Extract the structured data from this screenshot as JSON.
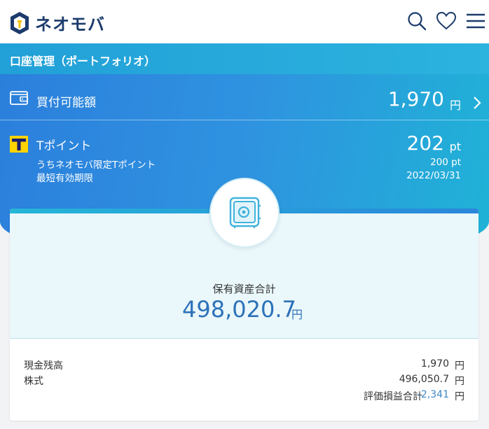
{
  "header": {
    "brand": "ネオモバ",
    "icons": [
      "search-icon",
      "heart-icon",
      "menu-icon"
    ]
  },
  "title_bar": {
    "title": "口座管理（ポートフォリオ）"
  },
  "buying_power": {
    "label": "買付可能額",
    "amount": "1,970",
    "unit": "円"
  },
  "tpoint": {
    "label": "Tポイント",
    "value": "202",
    "unit": "pt",
    "limited_label": "うちネオモバ限定Tポイント",
    "limited_value": "200 pt",
    "expiry_label": "最短有効期限",
    "expiry_value": "2022/03/31"
  },
  "assets": {
    "total_label": "保有資産合計",
    "total_value": "498,020.7",
    "unit": "円",
    "rows": [
      {
        "label": "現金残高",
        "value": "1,970",
        "unit": "円"
      },
      {
        "label": "株式",
        "value": "496,050.7",
        "unit": "円"
      },
      {
        "label": "評価損益合計",
        "value": "-2,341",
        "unit": "円"
      }
    ]
  },
  "colors": {
    "brand_navy": "#1c3b6c",
    "brand_yellow": "#f2c200",
    "hero_blue": "#2b7fdc",
    "accent_cyan": "#25b6d8",
    "value_blue": "#2d72b8"
  }
}
